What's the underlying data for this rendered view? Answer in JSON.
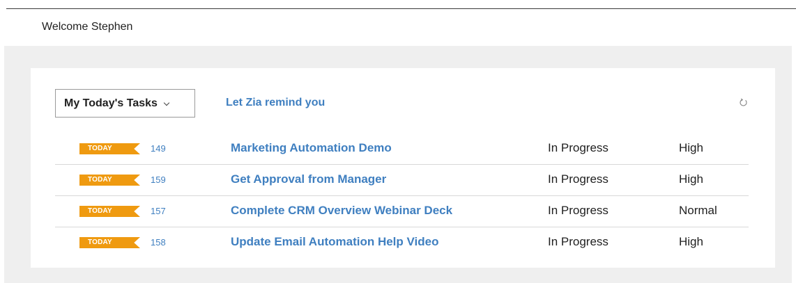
{
  "welcome": "Welcome Stephen",
  "widget": {
    "selector_label": "My Today's Tasks",
    "zia_link": "Let Zia remind you",
    "refresh_icon": "refresh-icon"
  },
  "tasks": [
    {
      "badge": "TODAY",
      "id": "149",
      "title": "Marketing Automation Demo",
      "status": "In Progress",
      "priority": "High"
    },
    {
      "badge": "TODAY",
      "id": "159",
      "title": "Get Approval from Manager",
      "status": "In Progress",
      "priority": "High"
    },
    {
      "badge": "TODAY",
      "id": "157",
      "title": "Complete CRM Overview Webinar Deck",
      "status": "In Progress",
      "priority": "Normal"
    },
    {
      "badge": "TODAY",
      "id": "158",
      "title": "Update Email Automation Help Video",
      "status": "In Progress",
      "priority": "High"
    }
  ],
  "colors": {
    "badge": "#ef9a10",
    "link": "#3f7fc0",
    "band": "#efefef"
  }
}
